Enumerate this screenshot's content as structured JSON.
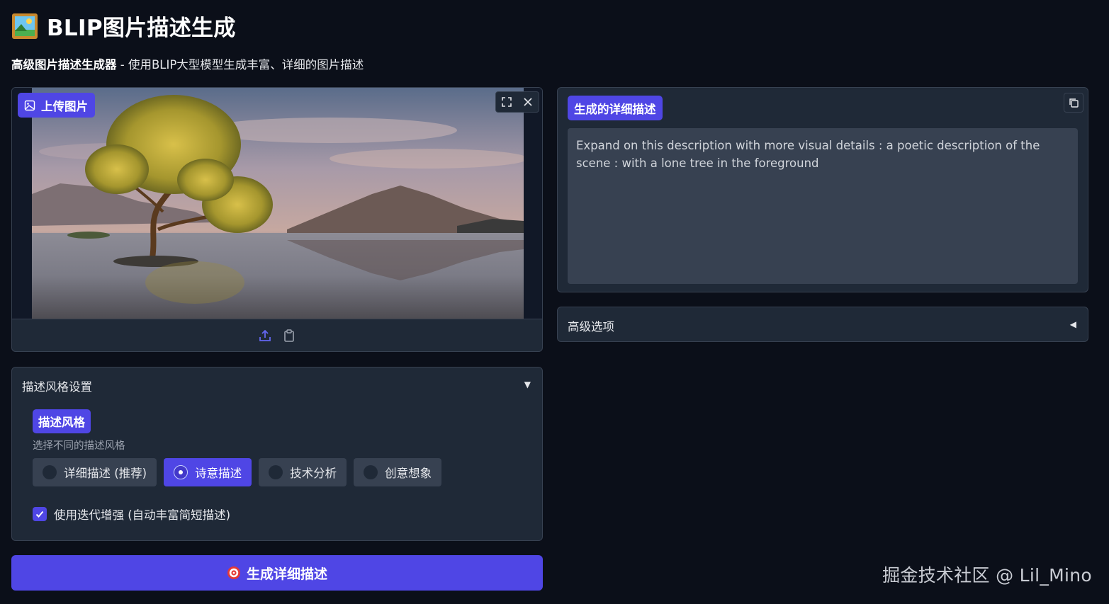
{
  "header": {
    "title": "BLIP图片描述生成",
    "subtitle_bold": "高级图片描述生成器",
    "subtitle_rest": " - 使用BLIP大型模型生成丰富、详细的图片描述"
  },
  "image_panel": {
    "badge_label": "上传图片",
    "tools": [
      "fullscreen-icon",
      "close-icon"
    ],
    "bottom_tools": [
      "upload-icon",
      "clipboard-icon"
    ]
  },
  "style_panel": {
    "title": "描述风格设置",
    "badge_label": "描述风格",
    "info": "选择不同的描述风格",
    "options": [
      "详细描述 (推荐)",
      "诗意描述",
      "技术分析",
      "创意想象"
    ],
    "selected": "诗意描述",
    "checkbox_label": "使用迭代增强 (自动丰富简短描述)",
    "checkbox_checked": true
  },
  "generate_button": {
    "label": "生成详细描述"
  },
  "output_panel": {
    "badge_label": "生成的详细描述",
    "text": "Expand on this description with more visual details : a poetic description of the scene : with a lone tree in the foreground"
  },
  "advanced": {
    "title": "高级选项"
  },
  "watermark": "掘金技术社区 @ Lil_Mino",
  "colors": {
    "background": "#0b0f19",
    "panel": "#1f2937",
    "accent": "#4f46e5",
    "input": "#374151"
  }
}
